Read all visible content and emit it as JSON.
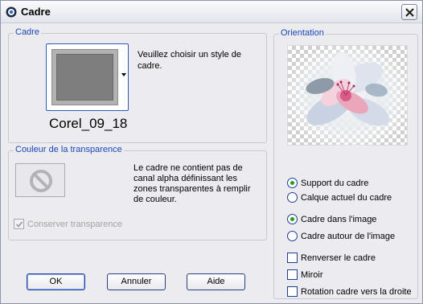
{
  "window": {
    "title": "Cadre",
    "icons": {
      "app": "psp-app-icon",
      "close": "close-icon"
    }
  },
  "cadre": {
    "label": "Cadre",
    "frame_name": "Corel_09_18",
    "hint": "Veuillez choisir un style de cadre."
  },
  "couleur": {
    "label": "Couleur de la transparence",
    "note": "Le cadre ne contient pas de canal alpha définissant les zones transparentes à remplir de couleur.",
    "conserver_label": "Conserver transparence",
    "conserver_checked": true,
    "conserver_disabled": true
  },
  "orientation": {
    "label": "Orientation",
    "radios_group1": [
      {
        "label": "Support du cadre",
        "checked": true
      },
      {
        "label": "Calque actuel du cadre",
        "checked": false
      }
    ],
    "radios_group2": [
      {
        "label": "Cadre dans l'image",
        "checked": true
      },
      {
        "label": "Cadre autour de l'image",
        "checked": false
      }
    ],
    "checkboxes": [
      {
        "label": "Renverser le cadre",
        "checked": false
      },
      {
        "label": "Miroir",
        "checked": false
      },
      {
        "label": "Rotation cadre vers la droite",
        "checked": false
      }
    ]
  },
  "buttons": {
    "ok": "OK",
    "cancel": "Annuler",
    "help": "Aide"
  },
  "colors": {
    "group_label": "#1a46b8",
    "radio_dot": "#21a121",
    "border_blue": "#1c3f94"
  }
}
